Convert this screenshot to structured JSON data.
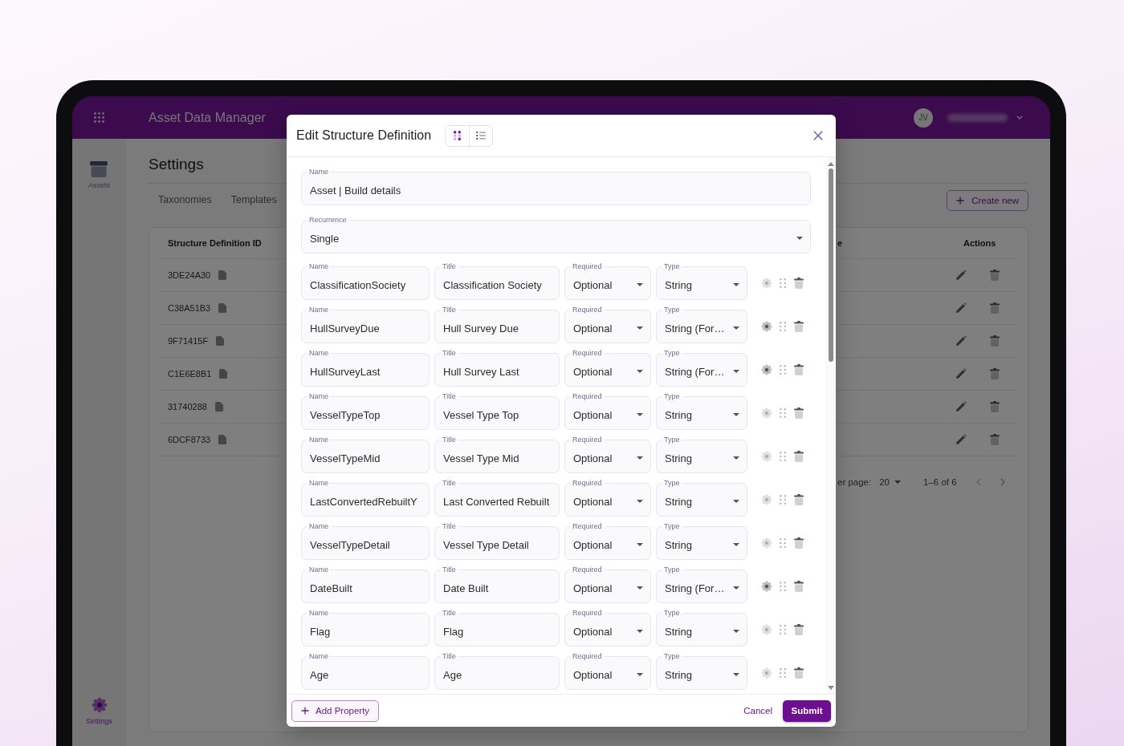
{
  "app_header": {
    "title": "Asset Data Manager",
    "avatar_initials": "JV"
  },
  "sidebar": {
    "items": [
      {
        "label": "Assets",
        "selected": false
      },
      {
        "label": "Settings",
        "selected": true
      }
    ]
  },
  "page": {
    "title": "Settings",
    "tabs": [
      {
        "label": "Taxonomies",
        "selected": false
      },
      {
        "label": "Templates",
        "selected": false
      }
    ],
    "create_button": "Create new"
  },
  "table": {
    "columns": [
      "Structure Definition ID",
      "e",
      "Actions"
    ],
    "rows": [
      {
        "id": "3DE24A30"
      },
      {
        "id": "C38A51B3"
      },
      {
        "id": "9F71415F"
      },
      {
        "id": "C1E6E8B1"
      },
      {
        "id": "31740288"
      },
      {
        "id": "6DCF8733"
      }
    ],
    "pagination": {
      "rows_per_page_label": "er page:",
      "rows_per_page": "20",
      "range": "1–6 of 6"
    }
  },
  "dialog": {
    "title": "Edit Structure Definition",
    "view_toggle": [
      {
        "kind": "grid",
        "selected": true
      },
      {
        "kind": "list",
        "selected": false
      }
    ],
    "name_field": {
      "label": "Name",
      "value": "Asset | Build details"
    },
    "recurrence_field": {
      "label": "Recurrence",
      "value": "Single"
    },
    "properties": [
      {
        "fields": [
          {
            "kind": "text",
            "label": "Name",
            "value": "ClassificationSociety"
          },
          {
            "kind": "text",
            "label": "Title",
            "value": "Classification Society"
          },
          {
            "kind": "select",
            "label": "Required",
            "value": "Optional"
          },
          {
            "kind": "select",
            "label": "Type",
            "value": "String"
          }
        ],
        "settings_active": false
      },
      {
        "fields": [
          {
            "kind": "text",
            "label": "Name",
            "value": "HullSurveyDue"
          },
          {
            "kind": "text",
            "label": "Title",
            "value": "Hull Survey Due"
          },
          {
            "kind": "select",
            "label": "Required",
            "value": "Optional"
          },
          {
            "kind": "select",
            "label": "Type",
            "value": "String (For…"
          }
        ],
        "settings_active": true
      },
      {
        "fields": [
          {
            "kind": "text",
            "label": "Name",
            "value": "HullSurveyLast"
          },
          {
            "kind": "text",
            "label": "Title",
            "value": "Hull Survey Last"
          },
          {
            "kind": "select",
            "label": "Required",
            "value": "Optional"
          },
          {
            "kind": "select",
            "label": "Type",
            "value": "String (For…"
          }
        ],
        "settings_active": true
      },
      {
        "fields": [
          {
            "kind": "text",
            "label": "Name",
            "value": "VesselTypeTop"
          },
          {
            "kind": "text",
            "label": "Title",
            "value": "Vessel Type Top"
          },
          {
            "kind": "select",
            "label": "Required",
            "value": "Optional"
          },
          {
            "kind": "select",
            "label": "Type",
            "value": "String"
          }
        ],
        "settings_active": false
      },
      {
        "fields": [
          {
            "kind": "text",
            "label": "Name",
            "value": "VesselTypeMid"
          },
          {
            "kind": "text",
            "label": "Title",
            "value": "Vessel Type Mid"
          },
          {
            "kind": "select",
            "label": "Required",
            "value": "Optional"
          },
          {
            "kind": "select",
            "label": "Type",
            "value": "String"
          }
        ],
        "settings_active": false
      },
      {
        "fields": [
          {
            "kind": "text",
            "label": "Name",
            "value": "LastConvertedRebuiltY"
          },
          {
            "kind": "text",
            "label": "Title",
            "value": "Last Converted Rebuilt"
          },
          {
            "kind": "select",
            "label": "Required",
            "value": "Optional"
          },
          {
            "kind": "select",
            "label": "Type",
            "value": "String"
          }
        ],
        "settings_active": false
      },
      {
        "fields": [
          {
            "kind": "text",
            "label": "Name",
            "value": "VesselTypeDetail"
          },
          {
            "kind": "text",
            "label": "Title",
            "value": "Vessel Type Detail"
          },
          {
            "kind": "select",
            "label": "Required",
            "value": "Optional"
          },
          {
            "kind": "select",
            "label": "Type",
            "value": "String"
          }
        ],
        "settings_active": false
      },
      {
        "fields": [
          {
            "kind": "text",
            "label": "Name",
            "value": "DateBuilt"
          },
          {
            "kind": "text",
            "label": "Title",
            "value": "Date Built"
          },
          {
            "kind": "select",
            "label": "Required",
            "value": "Optional"
          },
          {
            "kind": "select",
            "label": "Type",
            "value": "String (For…"
          }
        ],
        "settings_active": true
      },
      {
        "fields": [
          {
            "kind": "text",
            "label": "Name",
            "value": "Flag"
          },
          {
            "kind": "text",
            "label": "Title",
            "value": "Flag"
          },
          {
            "kind": "select",
            "label": "Required",
            "value": "Optional"
          },
          {
            "kind": "select",
            "label": "Type",
            "value": "String"
          }
        ],
        "settings_active": false
      },
      {
        "fields": [
          {
            "kind": "text",
            "label": "Name",
            "value": "Age"
          },
          {
            "kind": "text",
            "label": "Title",
            "value": "Age"
          },
          {
            "kind": "select",
            "label": "Required",
            "value": "Optional"
          },
          {
            "kind": "select",
            "label": "Type",
            "value": "String"
          }
        ],
        "settings_active": false
      }
    ],
    "add_button": "Add Property",
    "cancel_button": "Cancel",
    "submit_button": "Submit"
  }
}
